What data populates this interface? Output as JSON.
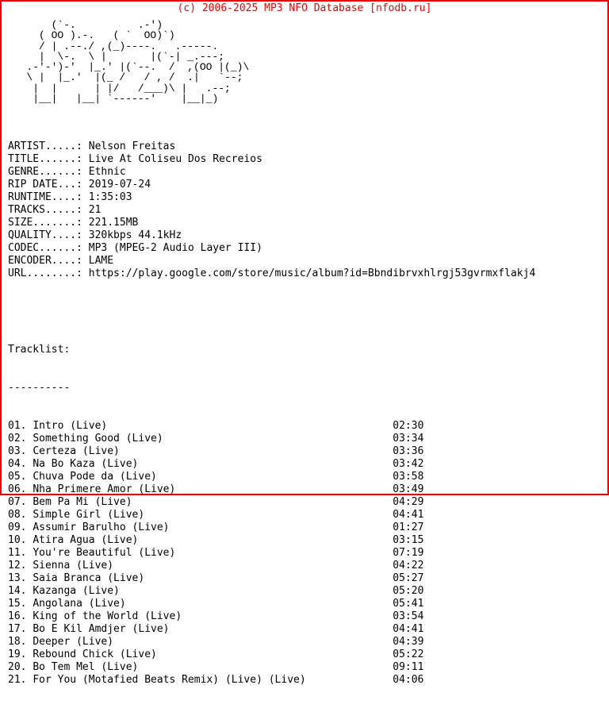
{
  "header": {
    "copyright": "(c) 2006-2025 MP3 NFO Database [nfodb.ru]",
    "accent_color": "#ee0000",
    "text_color": "#000000",
    "background_color": "#ffffff"
  },
  "ascii_logo": {
    "name": "mp3-nfo-ascii-logo",
    "lines": [
      "       (`-.          .-')",
      "     ( OO ).-.   ( `  OO)`)",
      "     / | .--./ ,(_)----.   .-----.",
      "     |  \\-.  \\ |       |(`-| _.---;",
      "   .-'-')-'  |_.' |(`--.  /  ,(OO |(_)\\",
      "   \\ |  |_.'  |(_ /   / , /  .|   `--;",
      "    |  |      | |/   /___)\\ |   .--;",
      "    |__|   |__| `------'    |__|_)"
    ]
  },
  "info": {
    "fields": [
      {
        "label": "ARTIST.....:",
        "value": "Nelson Freitas"
      },
      {
        "label": "TITLE......:",
        "value": "Live At Coliseu Dos Recreios"
      },
      {
        "label": "GENRE......:",
        "value": "Ethnic"
      },
      {
        "label": "RIP DATE...:",
        "value": "2019-07-24"
      },
      {
        "label": "RUNTIME....:",
        "value": "1:35:03"
      },
      {
        "label": "TRACKS.....:",
        "value": "21"
      },
      {
        "label": "SIZE.......:",
        "value": "221.15MB"
      },
      {
        "label": "QUALITY....:",
        "value": "320kbps 44.1kHz"
      },
      {
        "label": "CODEC......:",
        "value": "MP3 (MPEG-2 Audio Layer III)"
      },
      {
        "label": "ENCODER....:",
        "value": "LAME"
      },
      {
        "label": "URL........:",
        "value": "https://play.google.com/store/music/album?id=Bbndibrvxhlrgj53gvrmxflakj4"
      }
    ]
  },
  "tracklist": {
    "title": "Tracklist:",
    "rule": "----------",
    "tracks": [
      {
        "num": "01.",
        "title": "Intro (Live)",
        "duration": "02:30"
      },
      {
        "num": "02.",
        "title": "Something Good (Live)",
        "duration": "03:34"
      },
      {
        "num": "03.",
        "title": "Certeza (Live)",
        "duration": "03:36"
      },
      {
        "num": "04.",
        "title": "Na Bo Kaza (Live)",
        "duration": "03:42"
      },
      {
        "num": "05.",
        "title": "Chuva Pode da (Live)",
        "duration": "03:58"
      },
      {
        "num": "06.",
        "title": "Nha Primere Amor (Live)",
        "duration": "03:49"
      },
      {
        "num": "07.",
        "title": "Bem Pa Mi (Live)",
        "duration": "04:29"
      },
      {
        "num": "08.",
        "title": "Simple Girl (Live)",
        "duration": "04:41"
      },
      {
        "num": "09.",
        "title": "Assumir Barulho (Live)",
        "duration": "01:27"
      },
      {
        "num": "10.",
        "title": "Atira Agua (Live)",
        "duration": "03:15"
      },
      {
        "num": "11.",
        "title": "You're Beautiful (Live)",
        "duration": "07:19"
      },
      {
        "num": "12.",
        "title": "Sienna (Live)",
        "duration": "04:22"
      },
      {
        "num": "13.",
        "title": "Saia Branca (Live)",
        "duration": "05:27"
      },
      {
        "num": "14.",
        "title": "Kazanga (Live)",
        "duration": "05:20"
      },
      {
        "num": "15.",
        "title": "Angolana (Live)",
        "duration": "05:41"
      },
      {
        "num": "16.",
        "title": "King of the World (Live)",
        "duration": "03:54"
      },
      {
        "num": "17.",
        "title": "Bo E Kil Amdjer (Live)",
        "duration": "04:41"
      },
      {
        "num": "18.",
        "title": "Deeper (Live)",
        "duration": "04:39"
      },
      {
        "num": "19.",
        "title": "Rebound Chick (Live)",
        "duration": "05:22"
      },
      {
        "num": "20.",
        "title": "Bo Tem Mel (Live)",
        "duration": "09:11"
      },
      {
        "num": "21.",
        "title": "For You (Motafied Beats Remix) (Live) (Live)",
        "duration": "04:06"
      }
    ]
  }
}
